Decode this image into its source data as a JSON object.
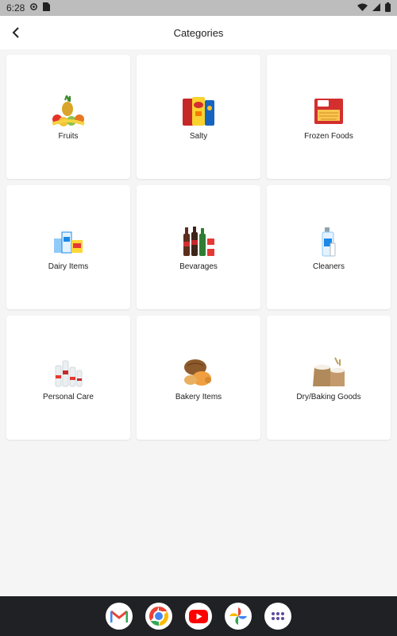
{
  "status_bar": {
    "time": "6:28"
  },
  "header": {
    "title": "Categories"
  },
  "categories": [
    {
      "label": "Fruits"
    },
    {
      "label": "Salty"
    },
    {
      "label": "Frozen Foods"
    },
    {
      "label": "Dairy Items"
    },
    {
      "label": "Bevarages"
    },
    {
      "label": "Cleaners"
    },
    {
      "label": "Personal Care"
    },
    {
      "label": "Bakery Items"
    },
    {
      "label": "Dry/Baking Goods"
    }
  ],
  "dock": {
    "apps": [
      "gmail-icon",
      "chrome-icon",
      "youtube-icon",
      "photos-icon",
      "app-drawer-icon"
    ]
  },
  "colors": {
    "status_bar_bg": "#bdbdbd",
    "app_bar_bg": "#ffffff",
    "page_bg": "#f5f5f5",
    "card_bg": "#ffffff",
    "nav_bar_bg": "#202124"
  }
}
